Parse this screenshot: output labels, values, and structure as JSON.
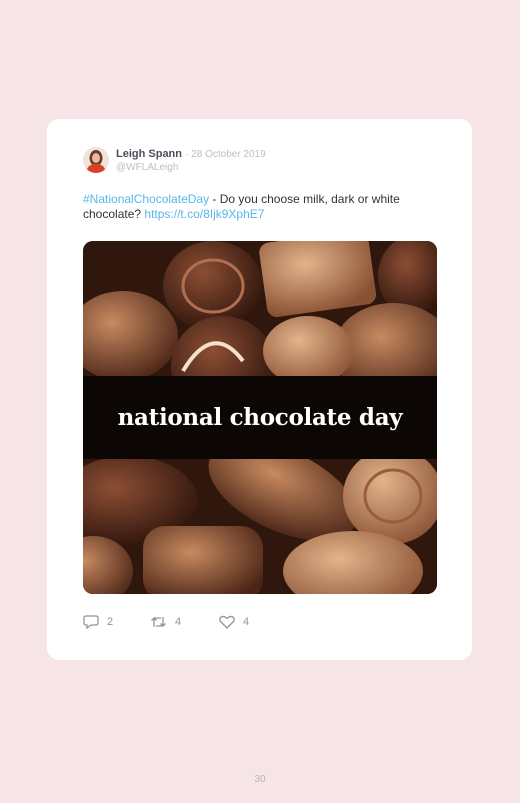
{
  "tweet": {
    "author_name": "Leigh Spann",
    "date": "· 28 October 2019",
    "handle": "@WFLALeigh",
    "hashtag": "#NationalChocolateDay",
    "text": " - Do you choose milk, dark or white chocolate? ",
    "link": "https://t.co/8Ijk9XphE7",
    "image_caption": "national chocolate day"
  },
  "actions": {
    "replies": "2",
    "retweets": "4",
    "likes": "4"
  },
  "page_number": "30",
  "colors": {
    "background": "#f6e4e6",
    "card": "#ffffff",
    "link": "#58b7e8"
  },
  "icons": [
    "reply-icon",
    "retweet-icon",
    "like-icon"
  ]
}
